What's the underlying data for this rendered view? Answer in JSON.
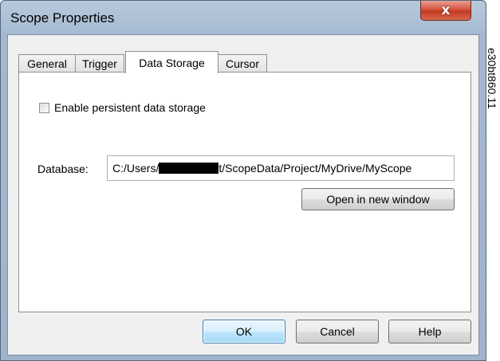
{
  "window": {
    "title": "Scope Properties",
    "close_symbol": "x"
  },
  "tabs": [
    {
      "label": "General",
      "active": false
    },
    {
      "label": "Trigger",
      "active": false
    },
    {
      "label": "Data Storage",
      "active": true
    },
    {
      "label": "Cursor",
      "active": false
    }
  ],
  "data_storage": {
    "persistent_checkbox_label": "Enable persistent data storage",
    "persistent_checked": false,
    "database_label": "Database:",
    "database_path_prefix": "C:/Users/",
    "database_path_suffix": "t/ScopeData/Project/MyDrive/MyScope",
    "open_button": "Open in new window"
  },
  "footer": {
    "ok": "OK",
    "cancel": "Cancel",
    "help": "Help"
  },
  "side_label": "e30bt860.11",
  "colors": {
    "close_button": "#c23a22",
    "default_button_border": "#3c7fb1",
    "title_bar": "#a4b9d0"
  }
}
